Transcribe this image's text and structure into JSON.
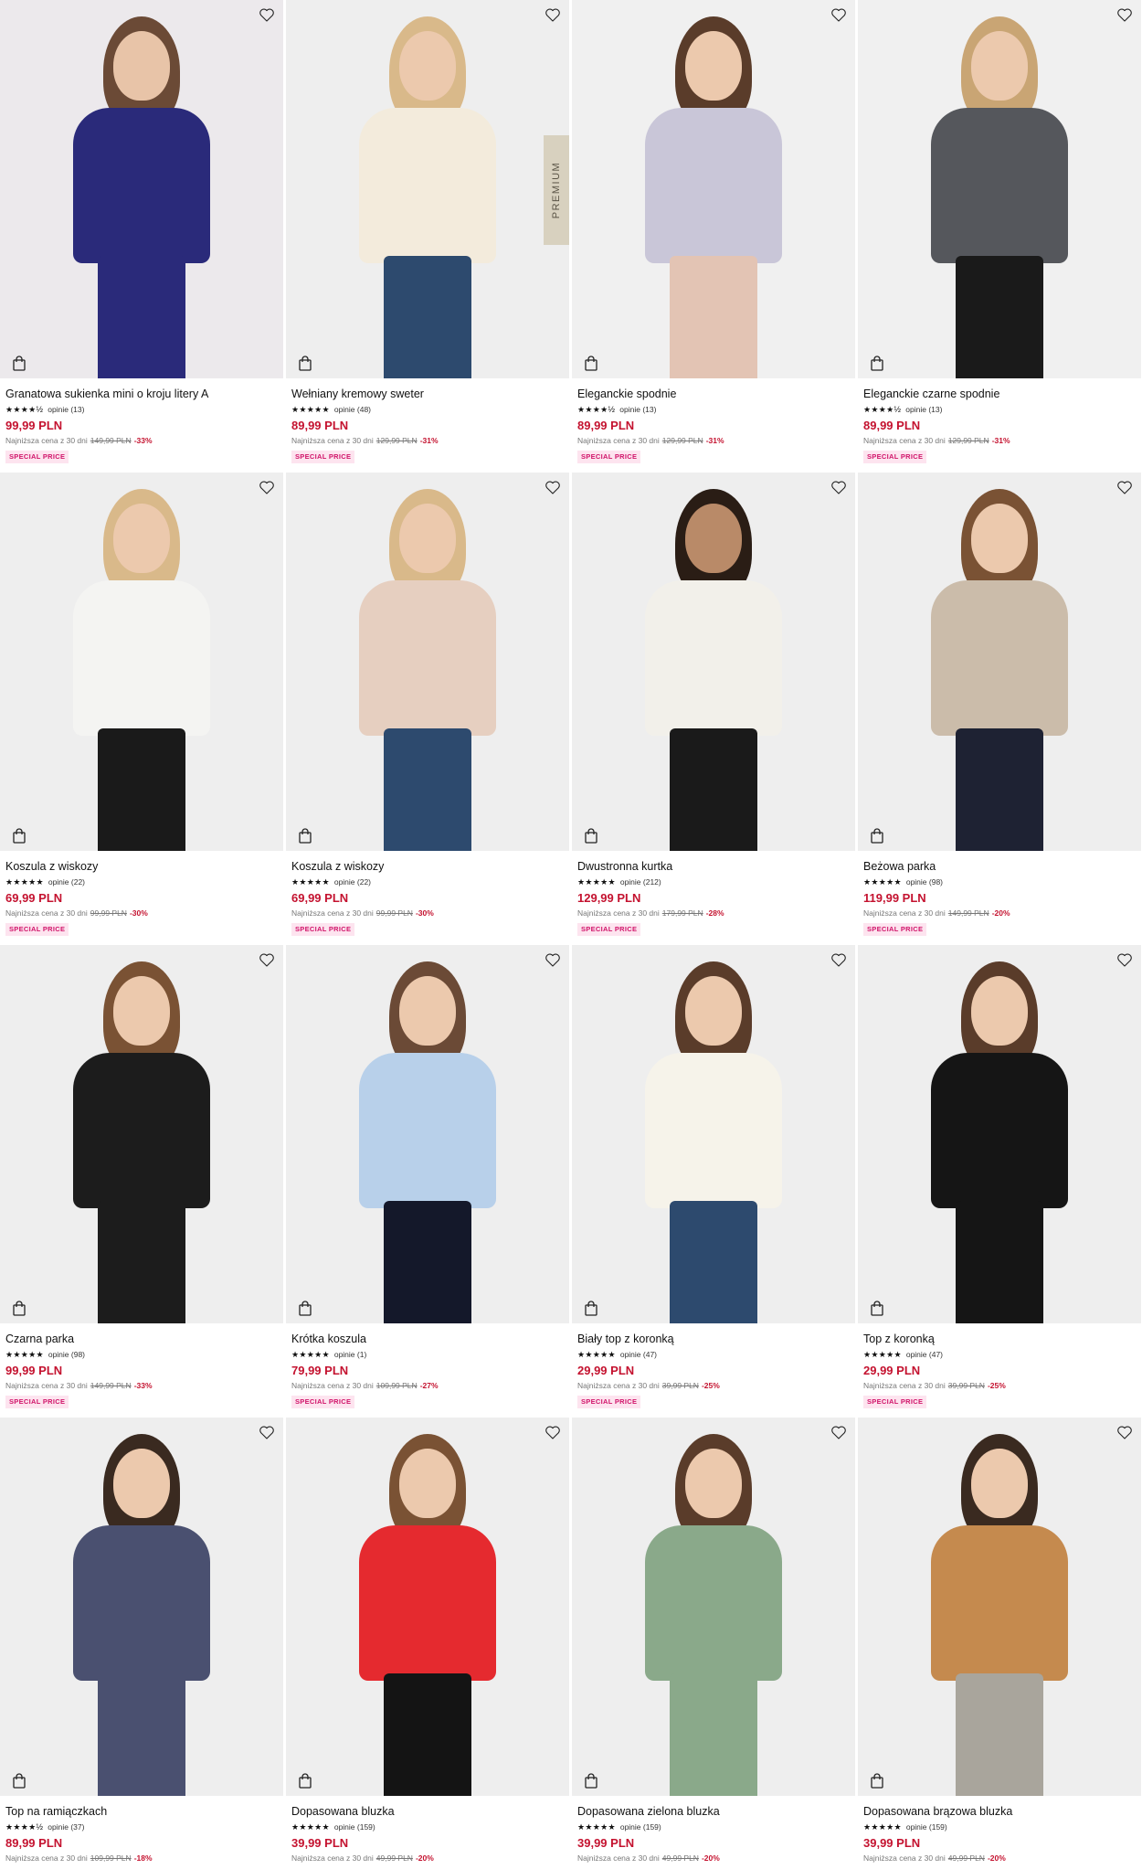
{
  "colors": {
    "price_red": "#c4122f",
    "badge_text": "#d1146a",
    "badge_bg": "#fde4ef"
  },
  "common": {
    "lowest_label": "Najniższa cena z 30 dni",
    "badge_label": "SPECIAL PRICE",
    "premium_label": "PREMIUM"
  },
  "products": [
    {
      "title": "Granatowa sukienka mini o kroju litery A",
      "stars": "★★★★½",
      "reviews": "opinie (13)",
      "price": "99,99 PLN",
      "old_price": "149,99 PLN",
      "discount": "-33%",
      "badge": true,
      "bg": "#ece9ec",
      "garment": "#2a2a7a",
      "legs": "#2a2a7a",
      "hair": "#6b4a36",
      "skin": "#e8c4a8"
    },
    {
      "title": "Wełniany kremowy sweter",
      "stars": "★★★★★",
      "reviews": "opinie (48)",
      "price": "89,99 PLN",
      "old_price": "129,99 PLN",
      "discount": "-31%",
      "badge": true,
      "premium": true,
      "bg": "#eeeeee",
      "garment": "#f3ebdc",
      "legs": "#2d4a6e",
      "hair": "#d9b98a",
      "skin": "#ecc9ad"
    },
    {
      "title": "Eleganckie spodnie",
      "stars": "★★★★½",
      "reviews": "opinie (13)",
      "price": "89,99 PLN",
      "old_price": "129,99 PLN",
      "discount": "-31%",
      "badge": true,
      "bg": "#f0f0f0",
      "garment": "#c9c6d8",
      "legs": "#e3c4b4",
      "hair": "#5a3c2a",
      "skin": "#ecc9ad"
    },
    {
      "title": "Eleganckie czarne spodnie",
      "stars": "★★★★½",
      "reviews": "opinie (13)",
      "price": "89,99 PLN",
      "old_price": "129,99 PLN",
      "discount": "-31%",
      "badge": true,
      "bg": "#f0f0f0",
      "garment": "#55575c",
      "legs": "#1a1a1a",
      "hair": "#c9a574",
      "skin": "#ecc9ad"
    },
    {
      "title": "Koszula z wiskozy",
      "stars": "★★★★★",
      "reviews": "opinie (22)",
      "price": "69,99 PLN",
      "old_price": "99,99 PLN",
      "discount": "-30%",
      "badge": true,
      "bg": "#eeeeee",
      "garment": "#f4f4f2",
      "legs": "#1a1a1a",
      "hair": "#d9b98a",
      "skin": "#ecc9ad"
    },
    {
      "title": "Koszula z wiskozy",
      "stars": "★★★★★",
      "reviews": "opinie (22)",
      "price": "69,99 PLN",
      "old_price": "99,99 PLN",
      "discount": "-30%",
      "badge": true,
      "bg": "#eeeeee",
      "garment": "#e6cfc0",
      "legs": "#2d4a6e",
      "hair": "#d9b98a",
      "skin": "#ecc9ad"
    },
    {
      "title": "Dwustronna kurtka",
      "stars": "★★★★★",
      "reviews": "opinie (212)",
      "price": "129,99 PLN",
      "old_price": "179,99 PLN",
      "discount": "-28%",
      "badge": true,
      "bg": "#eeeeee",
      "garment": "#f2f0ea",
      "legs": "#1a1a1a",
      "hair": "#2a1d15",
      "skin": "#b98a68"
    },
    {
      "title": "Beżowa parka",
      "stars": "★★★★★",
      "reviews": "opinie (98)",
      "price": "119,99 PLN",
      "old_price": "149,99 PLN",
      "discount": "-20%",
      "badge": true,
      "bg": "#eeeeee",
      "garment": "#cbbcaa",
      "legs": "#1e2233",
      "hair": "#7a5234",
      "skin": "#ecc9ad"
    },
    {
      "title": "Czarna parka",
      "stars": "★★★★★",
      "reviews": "opinie (98)",
      "price": "99,99 PLN",
      "old_price": "149,99 PLN",
      "discount": "-33%",
      "badge": true,
      "bg": "#eeeeee",
      "garment": "#1c1c1c",
      "legs": "#1c1c1c",
      "hair": "#7a5234",
      "skin": "#ecc9ad"
    },
    {
      "title": "Krótka koszula",
      "stars": "★★★★★",
      "reviews": "opinie (1)",
      "price": "79,99 PLN",
      "old_price": "109,99 PLN",
      "discount": "-27%",
      "badge": true,
      "bg": "#eeeeee",
      "garment": "#b8d0ea",
      "legs": "#14182a",
      "hair": "#6b4a36",
      "skin": "#ecc9ad"
    },
    {
      "title": "Biały top z koronką",
      "stars": "★★★★★",
      "reviews": "opinie (47)",
      "price": "29,99 PLN",
      "old_price": "39,99 PLN",
      "discount": "-25%",
      "badge": true,
      "bg": "#eeeeee",
      "garment": "#f6f3ea",
      "legs": "#2d4a6e",
      "hair": "#5a3c2a",
      "skin": "#ecc9ad"
    },
    {
      "title": "Top z koronką",
      "stars": "★★★★★",
      "reviews": "opinie (47)",
      "price": "29,99 PLN",
      "old_price": "39,99 PLN",
      "discount": "-25%",
      "badge": true,
      "bg": "#eeeeee",
      "garment": "#151515",
      "legs": "#151515",
      "hair": "#5a3c2a",
      "skin": "#ecc9ad"
    },
    {
      "title": "Top na ramiączkach",
      "stars": "★★★★½",
      "reviews": "opinie (37)",
      "price": "89,99 PLN",
      "old_price": "109,99 PLN",
      "discount": "-18%",
      "badge": false,
      "bg": "#eeeeee",
      "garment": "#4a5070",
      "legs": "#4a5070",
      "hair": "#3a2a20",
      "skin": "#ecc9ad"
    },
    {
      "title": "Dopasowana bluzka",
      "stars": "★★★★★",
      "reviews": "opinie (159)",
      "price": "39,99 PLN",
      "old_price": "49,99 PLN",
      "discount": "-20%",
      "badge": false,
      "bg": "#eeeeee",
      "garment": "#e52a2f",
      "legs": "#141414",
      "hair": "#7a5234",
      "skin": "#ecc9ad"
    },
    {
      "title": "Dopasowana zielona bluzka",
      "stars": "★★★★★",
      "reviews": "opinie (159)",
      "price": "39,99 PLN",
      "old_price": "49,99 PLN",
      "discount": "-20%",
      "badge": false,
      "bg": "#eeeeee",
      "garment": "#8aa98a",
      "legs": "#8aa98a",
      "hair": "#5a3c2a",
      "skin": "#ecc9ad"
    },
    {
      "title": "Dopasowana brązowa bluzka",
      "stars": "★★★★★",
      "reviews": "opinie (159)",
      "price": "39,99 PLN",
      "old_price": "49,99 PLN",
      "discount": "-20%",
      "badge": false,
      "bg": "#eeeeee",
      "garment": "#c58a4e",
      "legs": "#a9a59c",
      "hair": "#3a2a20",
      "skin": "#ecc9ad"
    }
  ]
}
